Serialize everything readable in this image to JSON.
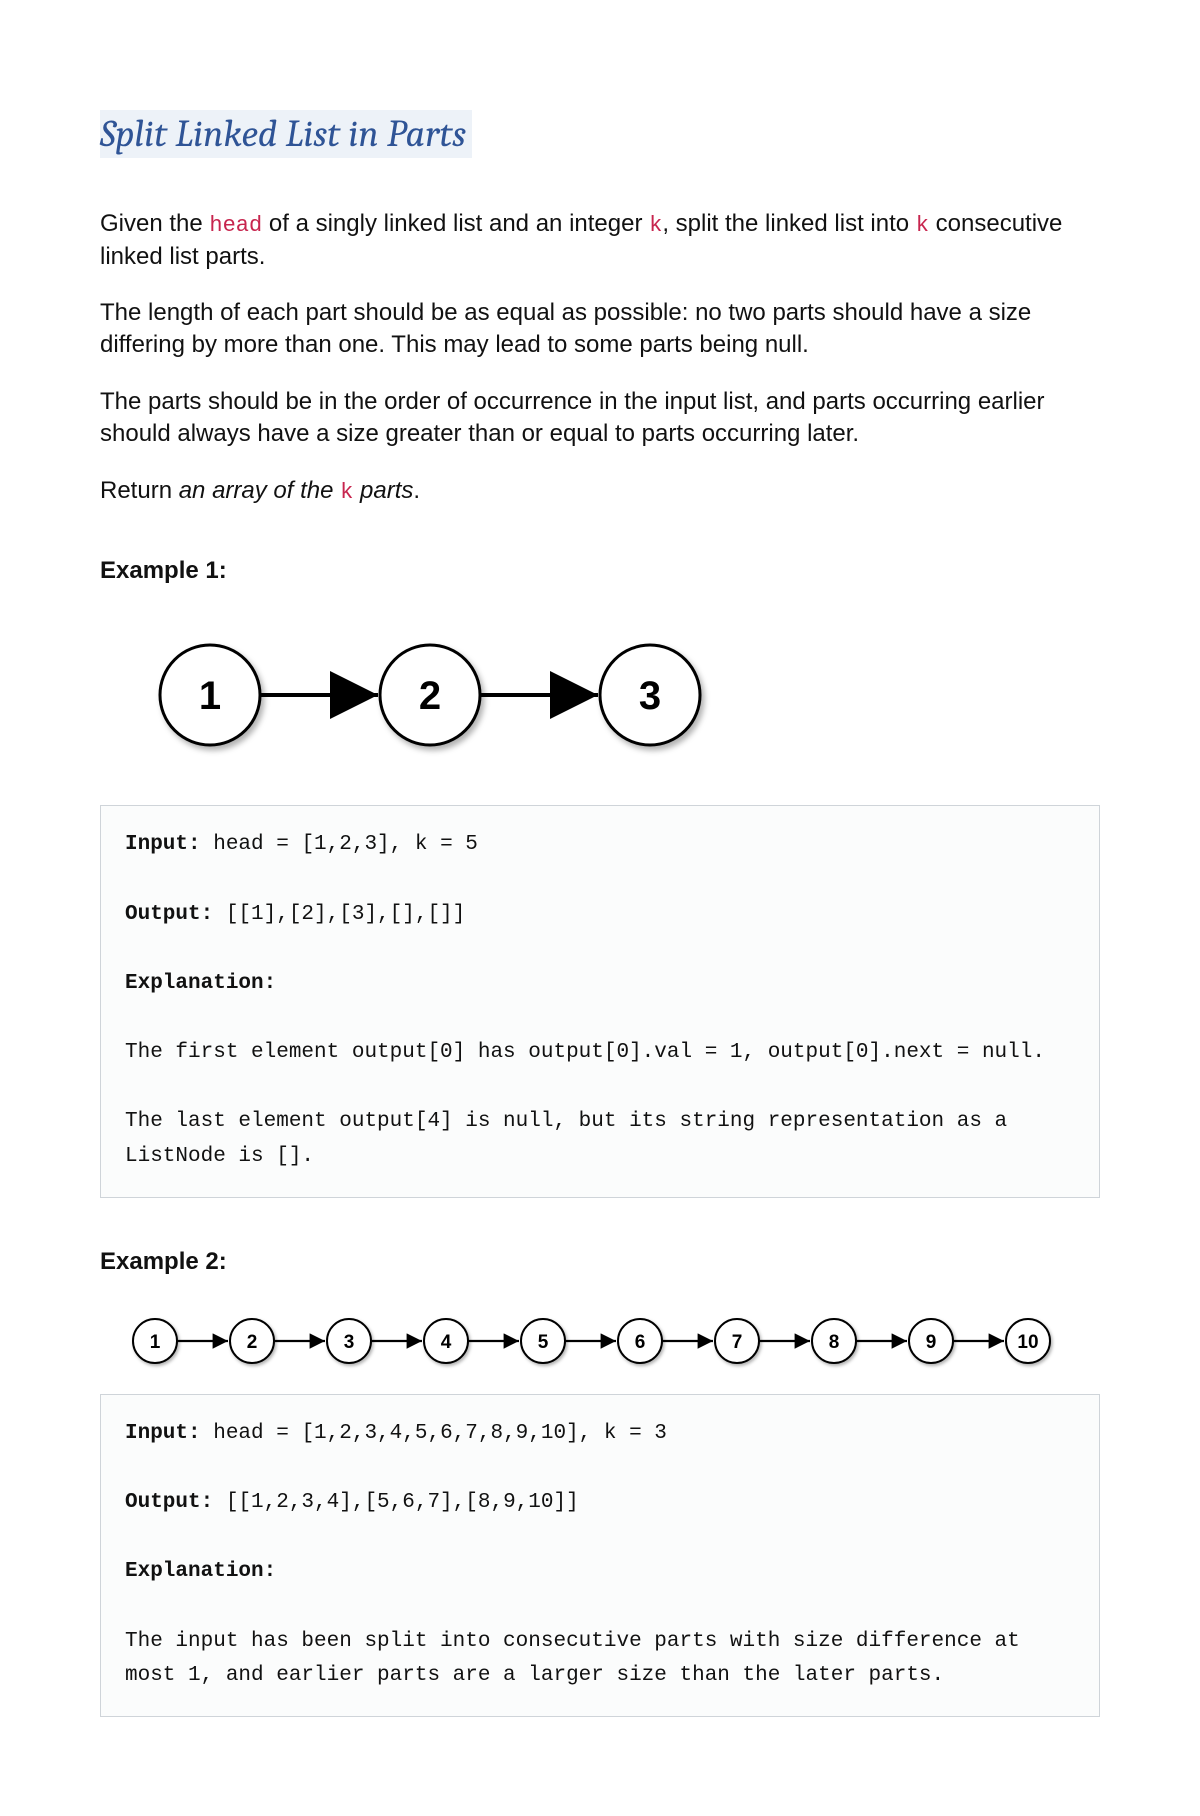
{
  "title": "Split Linked List in Parts",
  "p1a": "Given the ",
  "kw_head": "head",
  "p1b": " of a singly linked list and an integer ",
  "kw_k": "k",
  "p1c": ", split the linked list into ",
  "p1d": " consecutive linked list parts.",
  "p2": "The length of each part should be as equal as possible: no two parts should have a size differing by more than one. This may lead to some parts being null.",
  "p3": "The parts should be in the order of occurrence in the input list, and parts occurring earlier should always have a size greater than or equal to parts occurring later.",
  "p4a": "Return ",
  "p4b": "an array of the ",
  "p4c": " parts",
  "p4d": ".",
  "example1": {
    "heading": "Example 1:",
    "input_label": "Input:",
    "input_value": " head = [1,2,3], k = 5",
    "output_label": "Output:",
    "output_value": " [[1],[2],[3],[],[]]",
    "explanation_label": "Explanation:",
    "expl_line1": "The first element output[0] has output[0].val = 1, output[0].next = null.",
    "expl_line2": "The last element output[4] is null, but its string representation as a ListNode is []."
  },
  "diagram1": {
    "nodes": [
      "1",
      "2",
      "3"
    ]
  },
  "example2": {
    "heading": "Example 2:",
    "input_label": "Input:",
    "input_value": " head = [1,2,3,4,5,6,7,8,9,10], k = 3",
    "output_label": "Output:",
    "output_value": " [[1,2,3,4],[5,6,7],[8,9,10]]",
    "explanation_label": "Explanation:",
    "expl_line1": "The input has been split into consecutive parts with size difference at most 1, and earlier parts are a larger size than the later parts."
  },
  "diagram2": {
    "nodes": [
      "1",
      "2",
      "3",
      "4",
      "5",
      "6",
      "7",
      "8",
      "9",
      "10"
    ]
  }
}
